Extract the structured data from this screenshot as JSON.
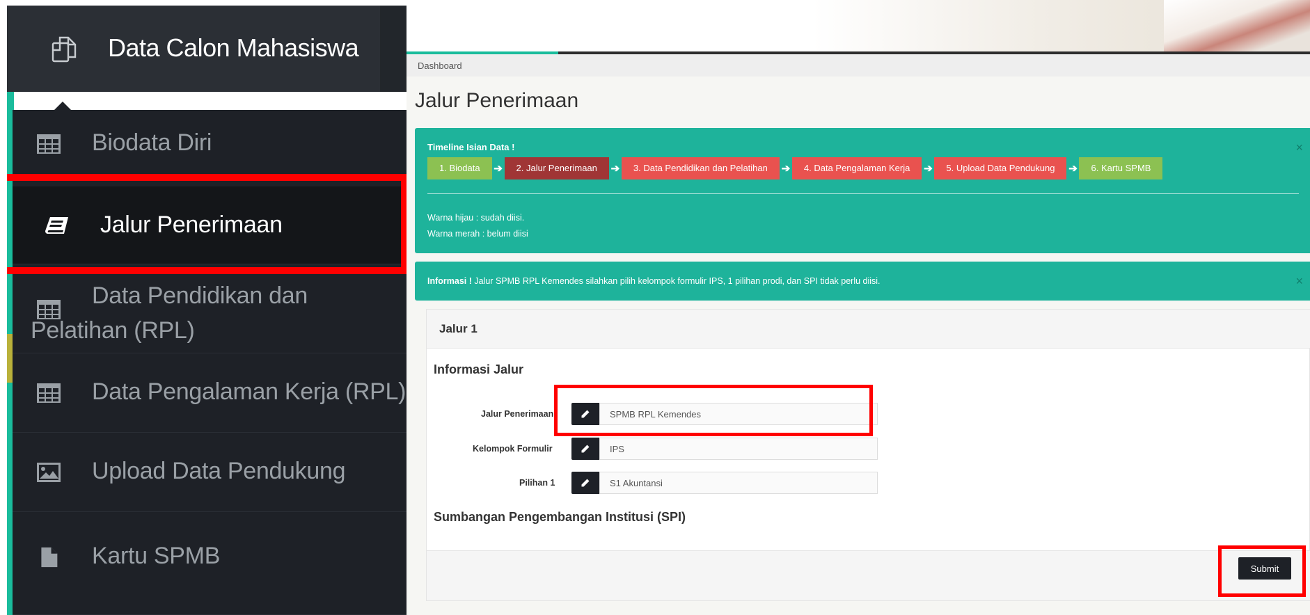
{
  "sidebar": {
    "header_title": "Data Calon Mahasiswa",
    "header_icon": "copy-icon",
    "items": [
      {
        "label": "Biodata Diri",
        "icon": "table-icon"
      },
      {
        "label": "Jalur Penerimaan",
        "icon": "book-icon",
        "active": true
      },
      {
        "label": "Data Pendidikan dan Pelatihan (RPL)",
        "icon": "table-icon"
      },
      {
        "label": "Data Pengalaman Kerja (RPL)",
        "icon": "table-icon"
      },
      {
        "label": "Upload Data Pendukung",
        "icon": "image-icon"
      },
      {
        "label": "Kartu SPMB",
        "icon": "file-icon"
      }
    ]
  },
  "breadcrumb": "Dashboard",
  "page_title": "Jalur Penerimaan",
  "timeline": {
    "title": "Timeline Isian Data !",
    "steps": [
      {
        "label": "1. Biodata",
        "status": "green"
      },
      {
        "label": "2. Jalur Penerimaan",
        "status": "active"
      },
      {
        "label": "3. Data Pendidikan dan Pelatihan",
        "status": "red"
      },
      {
        "label": "4. Data Pengalaman Kerja",
        "status": "red"
      },
      {
        "label": "5. Upload Data Pendukung",
        "status": "red"
      },
      {
        "label": "6. Kartu SPMB",
        "status": "green"
      }
    ],
    "legend_green": "Warna hijau : sudah diisi.",
    "legend_red": "Warna merah : belum diisi",
    "close": "×"
  },
  "info_alert": {
    "bold": "Informasi !",
    "text": " Jalur SPMB RPL Kemendes silahkan pilih kelompok formulir IPS, 1 pilihan prodi, dan SPI tidak perlu diisi.",
    "close": "×"
  },
  "panel": {
    "title": "Jalur 1",
    "section_info": "Informasi Jalur",
    "section_spi": "Sumbangan Pengembangan Institusi (SPI)",
    "fields": [
      {
        "label": "Jalur Penerimaan",
        "value": "SPMB RPL Kemendes"
      },
      {
        "label": "Kelompok Formulir",
        "value": "IPS"
      },
      {
        "label": "Pilihan 1",
        "value": "S1 Akuntansi"
      }
    ],
    "submit_label": "Submit"
  },
  "colors": {
    "teal": "#1eb39b",
    "step_green": "#8cc152",
    "step_active": "#a03535",
    "step_red": "#e9524f",
    "sidebar_dark": "#1e2127",
    "highlight": "#ff0000"
  }
}
